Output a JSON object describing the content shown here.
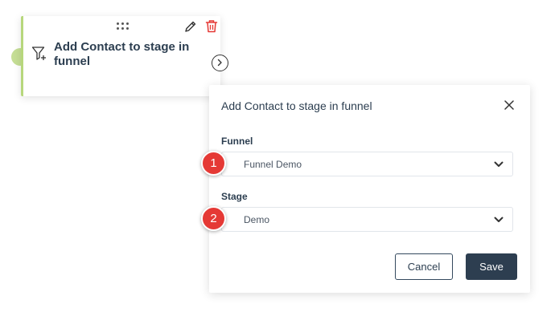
{
  "node": {
    "title": "Add Contact to stage in funnel",
    "icons": {
      "drag": "drag-handle-icon",
      "edit": "pencil-icon",
      "delete": "trash-icon",
      "type": "funnel-plus-icon",
      "expand": "chevron-right-icon"
    },
    "accent_color": "#b7d77c",
    "delete_color": "#e53935"
  },
  "panel": {
    "title": "Add Contact to stage in funnel",
    "fields": [
      {
        "label": "Funnel",
        "value": "Funnel Demo"
      },
      {
        "label": "Stage",
        "value": "Demo"
      }
    ],
    "buttons": {
      "cancel": "Cancel",
      "save": "Save"
    }
  },
  "markers": [
    "1",
    "2"
  ],
  "colors": {
    "primary": "#2d3e50",
    "marker": "#e53935"
  }
}
